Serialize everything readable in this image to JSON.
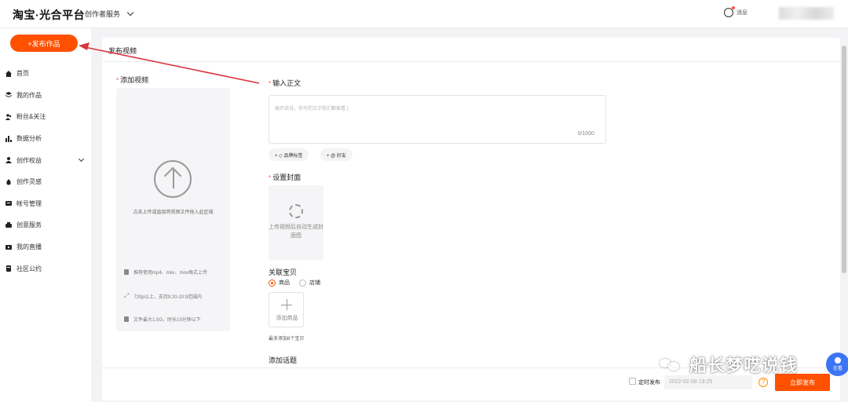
{
  "header": {
    "logo": "淘宝·光合平台",
    "service_menu": "创作者服务",
    "messages": "消息"
  },
  "sidebar": {
    "publish_button": "+发布作品",
    "items": [
      {
        "label": "首页",
        "icon": "home-icon"
      },
      {
        "label": "我的作品",
        "icon": "layers-icon"
      },
      {
        "label": "粉丝&关注",
        "icon": "users-icon"
      },
      {
        "label": "数据分析",
        "icon": "bar-chart-icon"
      },
      {
        "label": "创作权益",
        "icon": "person-icon"
      },
      {
        "label": "创作灵感",
        "icon": "flame-icon"
      },
      {
        "label": "帐号管理",
        "icon": "id-card-icon"
      },
      {
        "label": "创意服务",
        "icon": "service-icon"
      },
      {
        "label": "我的直播",
        "icon": "live-icon"
      },
      {
        "label": "社区公约",
        "icon": "book-icon"
      }
    ]
  },
  "main": {
    "title": "发布视频",
    "add_video": {
      "label": "添加视频",
      "upload_tip": "点击上传或直接将视频文件拖入此区域",
      "specs": [
        "推荐使用mp4、mkv、mov格式上传",
        "720p以上，支持9:20-20:9范围内",
        "文件最大1.5G，时长15分钟以下"
      ]
    },
    "text": {
      "label": "输入正文",
      "placeholder": "展开说说，你写的文字我们都爱看:)",
      "count": "0/1000",
      "tag_buttons": [
        "+ ◇ 品牌标签",
        "+ @ 好友"
      ]
    },
    "cover": {
      "label": "设置封面",
      "tip": "上传视频后自动生成封面图"
    },
    "related": {
      "label": "关联宝贝",
      "options": [
        "商品",
        "店铺"
      ],
      "selected": "商品",
      "add_label": "添加商品",
      "limit_note": "最多添加6个宝贝"
    },
    "topics": {
      "label": "添加话题"
    }
  },
  "footer": {
    "scheduled_label": "定时发布",
    "scheduled_value": "2022-02-08 19:25",
    "help": "?",
    "submit": "立即发布"
  },
  "watermark": {
    "text": "船长梦呓说钱",
    "bubble": "在看"
  },
  "colors": {
    "accent": "#ff5000",
    "arrow": "#d9363e",
    "bubble": "#3b74f5"
  }
}
